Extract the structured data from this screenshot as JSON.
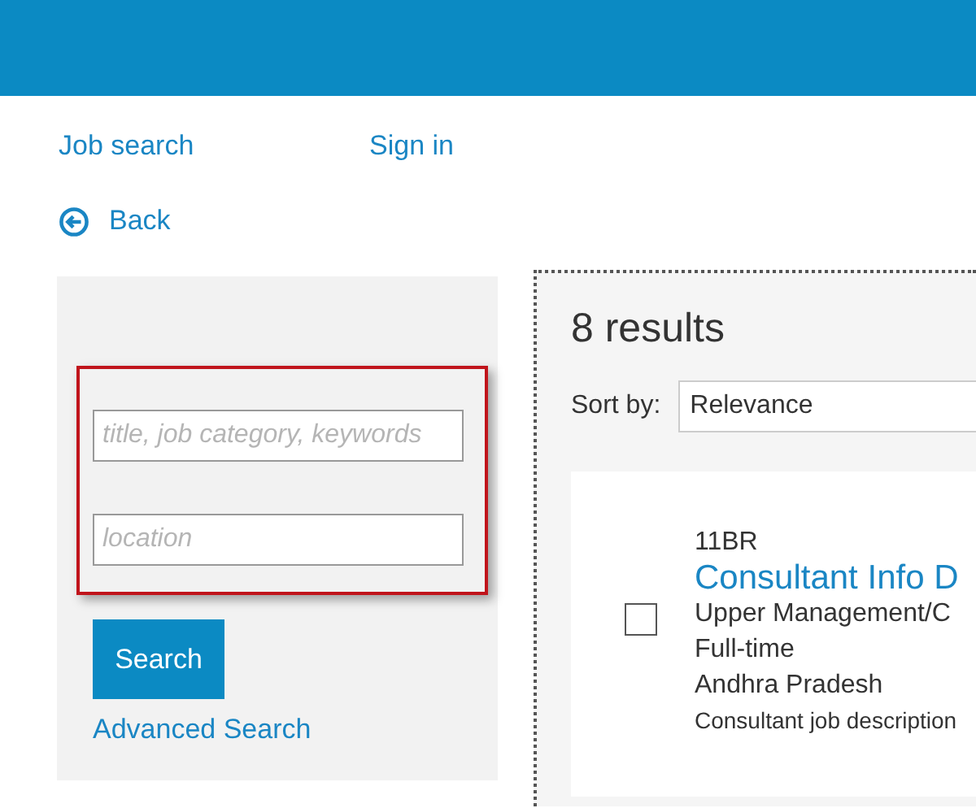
{
  "nav": [
    {
      "label": "Job search"
    },
    {
      "label": "Sign in"
    }
  ],
  "back": {
    "label": "Back"
  },
  "search": {
    "keywords_placeholder": "title, job category, keywords",
    "location_placeholder": "location",
    "button": "Search",
    "advanced": "Advanced Search"
  },
  "results": {
    "count": "8 results",
    "sort_label": "Sort by:",
    "sort_value": "Relevance",
    "jobs": [
      {
        "code": "11BR",
        "title": "Consultant Info D",
        "category": "Upper Management/C",
        "type": "Full-time",
        "location": "Andhra Pradesh",
        "description": "Consultant job description",
        "checked": false
      }
    ]
  }
}
